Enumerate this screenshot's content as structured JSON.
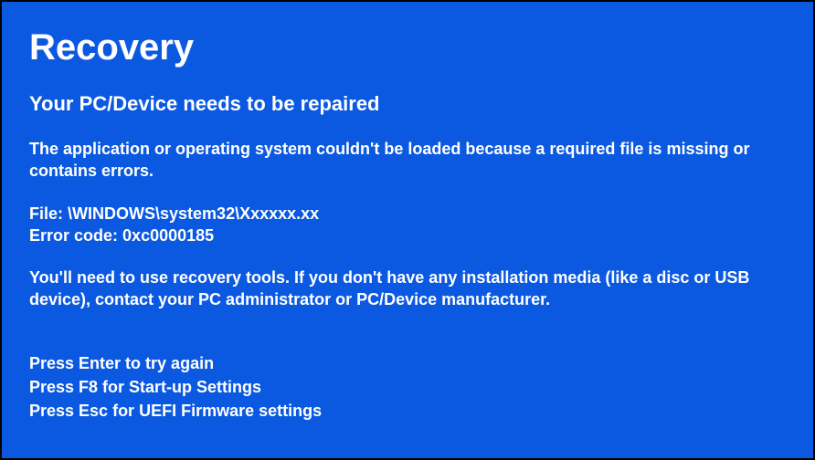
{
  "title": "Recovery",
  "subtitle": "Your PC/Device needs to be repaired",
  "error_description": "The application or operating system couldn't be loaded because a required file is missing or contains errors.",
  "file_label": "File:",
  "file_path": "\\WINDOWS\\system32\\Xxxxxx.xx",
  "error_code_label": "Error code:",
  "error_code": "0xc0000185",
  "recovery_hint": "You'll need to use recovery tools. If you don't have any installation media (like a disc or USB device), contact your PC administrator or PC/Device manufacturer.",
  "instructions": [
    "Press Enter to try again",
    "Press F8 for Start-up Settings",
    "Press Esc for UEFI Firmware settings"
  ]
}
